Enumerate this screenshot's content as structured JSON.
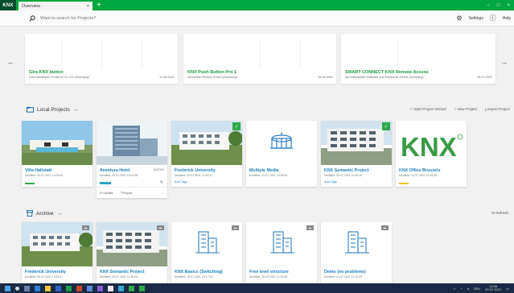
{
  "app": {
    "logo_text": "KNX"
  },
  "tab": {
    "label": "Overview",
    "close": "×",
    "add": "+"
  },
  "window": {
    "minimize": "–",
    "maximize": "□",
    "close": "×"
  },
  "search": {
    "placeholder": "Want to search for Projects?"
  },
  "toolbar": {
    "settings_label": "Settings",
    "help_label": "Help"
  },
  "recent": [
    {
      "name": "Gira KNX button",
      "sub": "Gira Giersiepen GmbH & Co. KG (Germany)",
      "date": "17.08.2021"
    },
    {
      "name": "KNX Push Button Pro 1",
      "sub": "Schneider Electric GmbH (Germany)",
      "date": "16.08.2021"
    },
    {
      "name": "SMART CONNECT KNX Remote Access",
      "sub": "Ise Individuelle Software und Elektronik GmbH (Germany)",
      "date": "16.07.2021"
    }
  ],
  "local": {
    "title": "Local Projects",
    "arrow": "→",
    "actions": [
      "Start Project Wizard",
      "New Project",
      "Import Project"
    ],
    "cards": [
      {
        "title": "Villa Hallstatt",
        "meta": "Modified: 20.07.2021 14:05:40",
        "tag": "",
        "bar_color": "#2eaa4a",
        "badge": ""
      },
      {
        "title": "Aventura Hotel",
        "meta": "Modified: 20.07.2021 14:02:38",
        "tag": "",
        "bar_color": "#2aa7c9",
        "badge": "",
        "extra": "BKE302",
        "expand": [
          "Update",
          "Export"
        ]
      },
      {
        "title": "Frederick University",
        "meta": "Modified: 20.07.2021 13:39:17",
        "tag": "Add Tags",
        "bar_color": "",
        "badge": "✓"
      },
      {
        "title": "Multiple Media",
        "meta": "Modified: 20.07.2021 13:08:46",
        "tag": "",
        "bar_color": "",
        "badge": ""
      },
      {
        "title": "KNX Semantic Project",
        "meta": "Modified: 20.07.2021 11:38:26",
        "tag": "Add Tags",
        "bar_color": "",
        "badge": "✓"
      },
      {
        "title": "KNX Office Brussels",
        "meta": "Modified: 20.07.2021 11:28:45",
        "tag": "",
        "bar_color": "#f2c12e",
        "badge": ""
      }
    ]
  },
  "archive": {
    "title": "Archive",
    "arrow": "→",
    "refresh": "Refresh",
    "cards": [
      {
        "title": "Frederick University",
        "meta": "Modified: 20.07.2021 13:39:17"
      },
      {
        "title": "KNX Semantic Project",
        "meta": "Modified: 20.07.2021 11:38:26"
      },
      {
        "title": "KNX Basics (Switching)",
        "meta": "Modified: 16.07.2021 10:17:05"
      },
      {
        "title": "Free level structure",
        "meta": "Modified: 16.03.2021 11:26:46"
      },
      {
        "title": "Demo (no problems)",
        "meta": "Modified: 01.07.2021 11:22:49"
      }
    ]
  },
  "taskbar": {
    "time": "14:06",
    "date": "20.07.2021",
    "lang": "DEU"
  }
}
